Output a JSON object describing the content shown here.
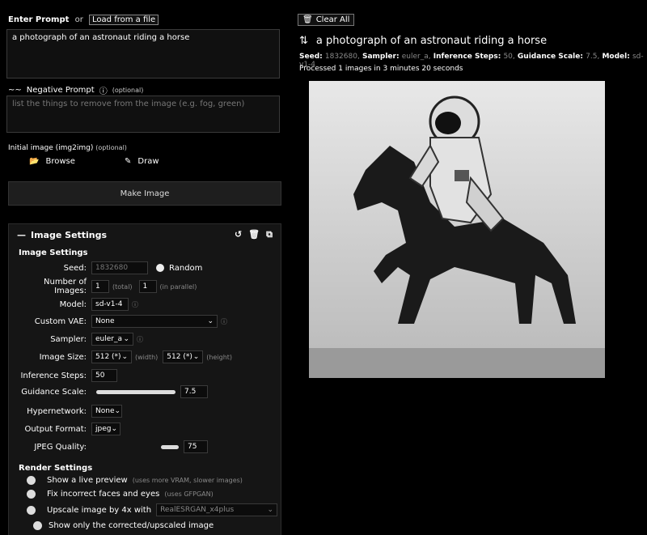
{
  "prompt": {
    "header_label": "Enter Prompt",
    "or_text": "or",
    "load_file_label": "Load from a file",
    "value": "a photograph of an astronaut riding a horse"
  },
  "negative": {
    "label": "Negative Prompt",
    "optional": "(optional)",
    "placeholder": "list the things to remove from the image (e.g. fog, green)"
  },
  "init_image": {
    "label": "Initial image (img2img)",
    "optional": "(optional)",
    "browse_label": "Browse",
    "draw_label": "Draw"
  },
  "make_button": "Make Image",
  "image_settings": {
    "title": "Image Settings",
    "section_title": "Image Settings",
    "seed": {
      "label": "Seed:",
      "value": "1832680",
      "random_label": "Random"
    },
    "num_images": {
      "label": "Number of Images:",
      "value": "1",
      "total_hint": "(total)",
      "parallel_value": "1",
      "parallel_hint": "(in parallel)"
    },
    "model": {
      "label": "Model:",
      "value": "sd-v1-4"
    },
    "custom_vae": {
      "label": "Custom VAE:",
      "value": "None"
    },
    "sampler": {
      "label": "Sampler:",
      "value": "euler_a"
    },
    "image_size": {
      "label": "Image Size:",
      "width": "512 (*)",
      "width_hint": "(width)",
      "height": "512 (*)",
      "height_hint": "(height)"
    },
    "inference_steps": {
      "label": "Inference Steps:",
      "value": "50"
    },
    "guidance_scale": {
      "label": "Guidance Scale:",
      "value": "7.5"
    },
    "hypernetwork": {
      "label": "Hypernetwork:",
      "value": "None"
    },
    "output_format": {
      "label": "Output Format:",
      "value": "jpeg"
    },
    "jpeg_quality": {
      "label": "JPEG Quality:",
      "value": "75"
    }
  },
  "render_settings": {
    "title": "Render Settings",
    "live_preview": {
      "label": "Show a live preview",
      "hint": "(uses more VRAM, slower images)"
    },
    "fix_faces": {
      "label": "Fix incorrect faces and eyes",
      "hint": "(uses GFPGAN)"
    },
    "upscale": {
      "label": "Upscale image by 4x with",
      "value": "RealESRGAN_x4plus"
    },
    "show_only": {
      "label": "Show only the corrected/upscaled image"
    }
  },
  "result": {
    "clear_all_label": "Clear All",
    "title": "a photograph of an astronaut riding a horse",
    "meta_seed_label": "Seed:",
    "meta_seed": "1832680,",
    "meta_sampler_label": "Sampler:",
    "meta_sampler": "euler_a,",
    "meta_steps_label": "Inference Steps:",
    "meta_steps": "50,",
    "meta_guidance_label": "Guidance Scale:",
    "meta_guidance": "7.5,",
    "meta_model_label": "Model:",
    "meta_model": "sd-v1-4",
    "time_text": "Processed 1 images in 3 minutes 20 seconds"
  }
}
